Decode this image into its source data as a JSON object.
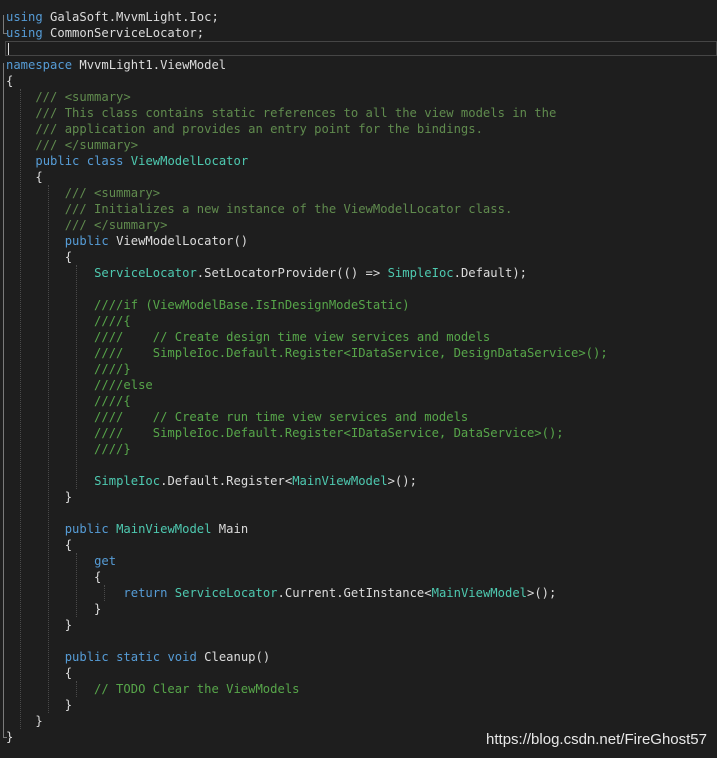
{
  "editor": {
    "lines": [
      [
        {
          "t": "using",
          "c": "kw"
        },
        {
          "t": " GalaSoft.MvvmLight.Ioc;",
          "c": "plain"
        }
      ],
      [
        {
          "t": "using",
          "c": "kw"
        },
        {
          "t": " CommonServiceLocator;",
          "c": "plain"
        }
      ],
      [],
      [
        {
          "t": "namespace",
          "c": "kw"
        },
        {
          "t": " MvvmLight1.ViewModel",
          "c": "plain"
        }
      ],
      [
        {
          "t": "{",
          "c": "plain"
        }
      ],
      [
        {
          "t": "    /// <summary>",
          "c": "doc"
        }
      ],
      [
        {
          "t": "    /// This class contains static references to all the view models in the",
          "c": "doc"
        }
      ],
      [
        {
          "t": "    /// application and provides an entry point for the bindings.",
          "c": "doc"
        }
      ],
      [
        {
          "t": "    /// </summary>",
          "c": "doc"
        }
      ],
      [
        {
          "t": "    ",
          "c": "plain"
        },
        {
          "t": "public",
          "c": "kw"
        },
        {
          "t": " ",
          "c": "plain"
        },
        {
          "t": "class",
          "c": "kw"
        },
        {
          "t": " ",
          "c": "plain"
        },
        {
          "t": "ViewModelLocator",
          "c": "type"
        }
      ],
      [
        {
          "t": "    {",
          "c": "plain"
        }
      ],
      [
        {
          "t": "        /// <summary>",
          "c": "doc"
        }
      ],
      [
        {
          "t": "        /// Initializes a new instance of the ViewModelLocator class.",
          "c": "doc"
        }
      ],
      [
        {
          "t": "        /// </summary>",
          "c": "doc"
        }
      ],
      [
        {
          "t": "        ",
          "c": "plain"
        },
        {
          "t": "public",
          "c": "kw"
        },
        {
          "t": " ViewModelLocator()",
          "c": "plain"
        }
      ],
      [
        {
          "t": "        {",
          "c": "plain"
        }
      ],
      [
        {
          "t": "            ",
          "c": "plain"
        },
        {
          "t": "ServiceLocator",
          "c": "type"
        },
        {
          "t": ".SetLocatorProvider(() => ",
          "c": "plain"
        },
        {
          "t": "SimpleIoc",
          "c": "type"
        },
        {
          "t": ".Default);",
          "c": "plain"
        }
      ],
      [],
      [
        {
          "t": "            ////if (ViewModelBase.IsInDesignModeStatic)",
          "c": "com"
        }
      ],
      [
        {
          "t": "            ////{",
          "c": "com"
        }
      ],
      [
        {
          "t": "            ////    // Create design time view services and models",
          "c": "com"
        }
      ],
      [
        {
          "t": "            ////    SimpleIoc.Default.Register<IDataService, DesignDataService>();",
          "c": "com"
        }
      ],
      [
        {
          "t": "            ////}",
          "c": "com"
        }
      ],
      [
        {
          "t": "            ////else",
          "c": "com"
        }
      ],
      [
        {
          "t": "            ////{",
          "c": "com"
        }
      ],
      [
        {
          "t": "            ////    // Create run time view services and models",
          "c": "com"
        }
      ],
      [
        {
          "t": "            ////    SimpleIoc.Default.Register<IDataService, DataService>();",
          "c": "com"
        }
      ],
      [
        {
          "t": "            ////}",
          "c": "com"
        }
      ],
      [],
      [
        {
          "t": "            ",
          "c": "plain"
        },
        {
          "t": "SimpleIoc",
          "c": "type"
        },
        {
          "t": ".Default.Register<",
          "c": "plain"
        },
        {
          "t": "MainViewModel",
          "c": "type"
        },
        {
          "t": ">();",
          "c": "plain"
        }
      ],
      [
        {
          "t": "        }",
          "c": "plain"
        }
      ],
      [],
      [
        {
          "t": "        ",
          "c": "plain"
        },
        {
          "t": "public",
          "c": "kw"
        },
        {
          "t": " ",
          "c": "plain"
        },
        {
          "t": "MainViewModel",
          "c": "type"
        },
        {
          "t": " Main",
          "c": "plain"
        }
      ],
      [
        {
          "t": "        {",
          "c": "plain"
        }
      ],
      [
        {
          "t": "            ",
          "c": "plain"
        },
        {
          "t": "get",
          "c": "kw"
        }
      ],
      [
        {
          "t": "            {",
          "c": "plain"
        }
      ],
      [
        {
          "t": "                ",
          "c": "plain"
        },
        {
          "t": "return",
          "c": "kw"
        },
        {
          "t": " ",
          "c": "plain"
        },
        {
          "t": "ServiceLocator",
          "c": "type"
        },
        {
          "t": ".Current.GetInstance<",
          "c": "plain"
        },
        {
          "t": "MainViewModel",
          "c": "type"
        },
        {
          "t": ">();",
          "c": "plain"
        }
      ],
      [
        {
          "t": "            }",
          "c": "plain"
        }
      ],
      [
        {
          "t": "        }",
          "c": "plain"
        }
      ],
      [],
      [
        {
          "t": "        ",
          "c": "plain"
        },
        {
          "t": "public",
          "c": "kw"
        },
        {
          "t": " ",
          "c": "plain"
        },
        {
          "t": "static",
          "c": "kw"
        },
        {
          "t": " ",
          "c": "plain"
        },
        {
          "t": "void",
          "c": "kw"
        },
        {
          "t": " Cleanup()",
          "c": "plain"
        }
      ],
      [
        {
          "t": "        {",
          "c": "plain"
        }
      ],
      [
        {
          "t": "            // TODO Clear the ViewModels",
          "c": "com"
        }
      ],
      [
        {
          "t": "        }",
          "c": "plain"
        }
      ],
      [
        {
          "t": "    }",
          "c": "plain"
        }
      ],
      [
        {
          "t": "}",
          "c": "plain"
        }
      ]
    ]
  },
  "watermark": "https://blog.csdn.net/FireGhost57",
  "colors": {
    "background": "#1e1e1e",
    "keyword": "#569cd6",
    "type": "#4ec9b0",
    "comment": "#57a64a",
    "plain": "#dcdcdc"
  }
}
